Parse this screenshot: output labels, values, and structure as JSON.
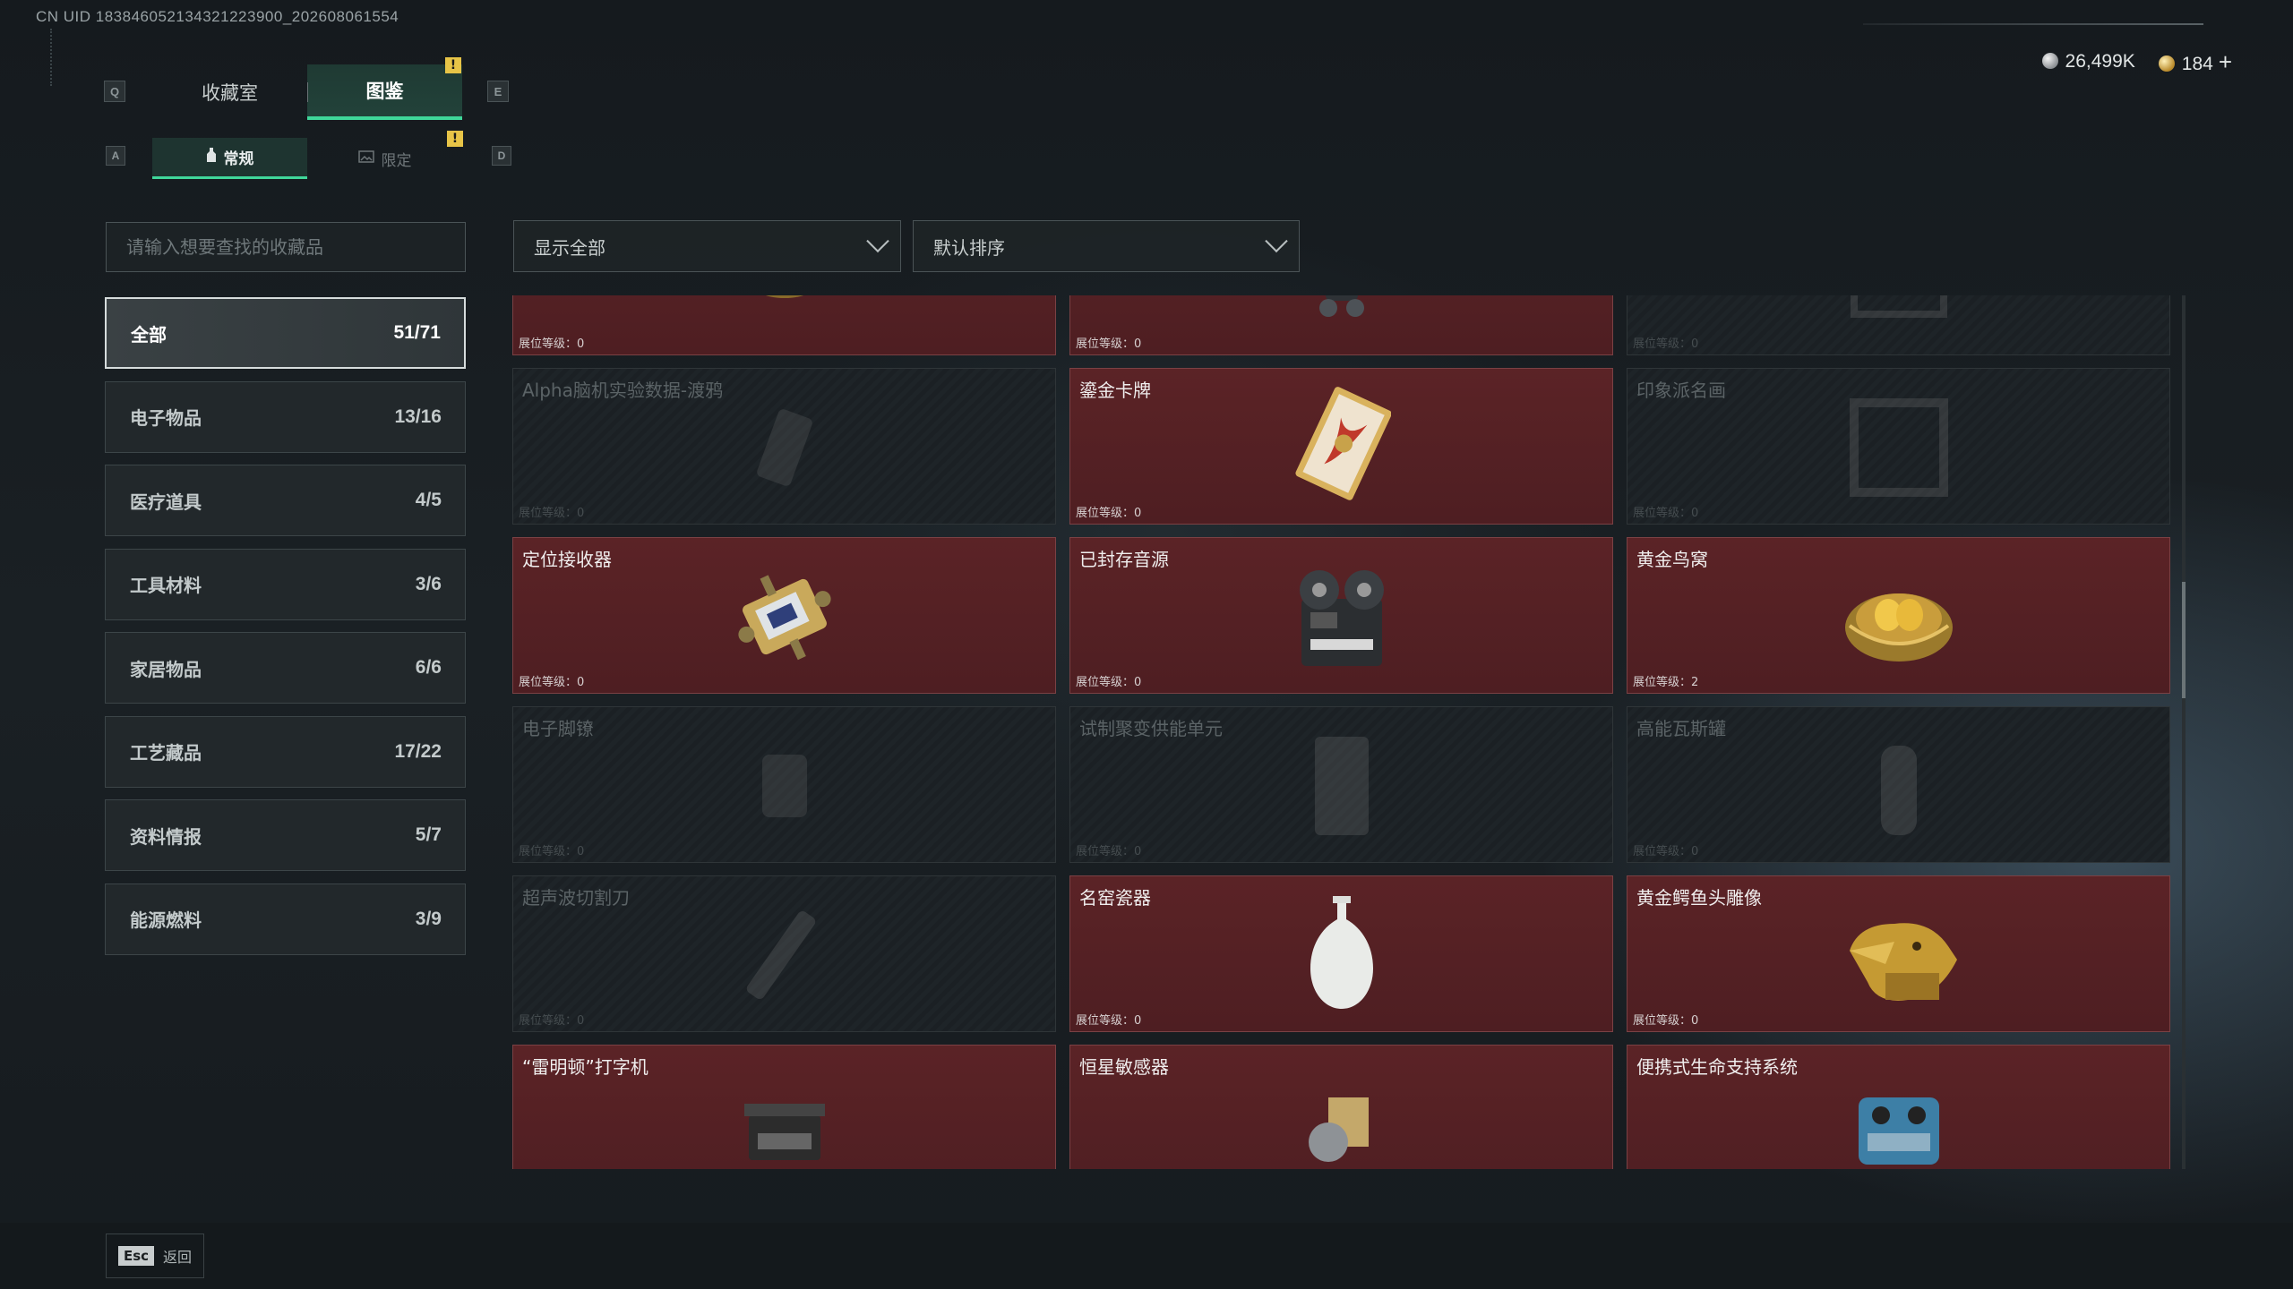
{
  "header": {
    "uid": "CN UID 18384605213432122390​0_202608061554",
    "tabs": [
      {
        "label": "收藏室",
        "active": false
      },
      {
        "label": "图鉴",
        "active": true
      }
    ],
    "tab_keys": {
      "prev": "Q",
      "next": "E"
    },
    "subtabs": [
      {
        "label": "常规",
        "active": true
      },
      {
        "label": "限定",
        "active": false
      }
    ],
    "subtab_keys": {
      "prev": "A",
      "next": "D"
    },
    "warning_mark": "!"
  },
  "currency": {
    "silver": "26,499K",
    "gold": "184",
    "plus": "+"
  },
  "search": {
    "placeholder": "请输入想要查找的收藏品",
    "value": ""
  },
  "filters": {
    "show": "显示全部",
    "sort": "默认排序"
  },
  "categories": [
    {
      "label": "全部",
      "count": "51/71",
      "active": true
    },
    {
      "label": "电子物品",
      "count": "13/16"
    },
    {
      "label": "医疗道具",
      "count": "4/5"
    },
    {
      "label": "工具材料",
      "count": "3/6"
    },
    {
      "label": "家居物品",
      "count": "6/6"
    },
    {
      "label": "工艺藏品",
      "count": "17/22"
    },
    {
      "label": "资料情报",
      "count": "5/7"
    },
    {
      "label": "能源燃料",
      "count": "3/9"
    }
  ],
  "items": [
    {
      "name": "",
      "level": "展位等级：0",
      "owned": true,
      "icon": "caviar-tin-icon"
    },
    {
      "name": "",
      "level": "展位等级：0",
      "owned": true,
      "icon": "device-icon"
    },
    {
      "name": "",
      "level": "展位等级：0",
      "owned": false,
      "icon": "frame-icon"
    },
    {
      "name": "Alpha脑机实验数据-渡鸦",
      "level": "展位等级：0",
      "owned": false,
      "icon": "data-drive-icon"
    },
    {
      "name": "鎏金卡牌",
      "level": "展位等级：0",
      "owned": true,
      "icon": "gilded-card-icon"
    },
    {
      "name": "印象派名画",
      "level": "展位等级：0",
      "owned": false,
      "icon": "painting-icon"
    },
    {
      "name": "定位接收器",
      "level": "展位等级：0",
      "owned": true,
      "icon": "locator-receiver-icon"
    },
    {
      "name": "已封存音源",
      "level": "展位等级：0",
      "owned": true,
      "icon": "tape-recorder-icon"
    },
    {
      "name": "黄金鸟窝",
      "level": "展位等级：2",
      "owned": true,
      "icon": "golden-nest-icon"
    },
    {
      "name": "电子脚镣",
      "level": "展位等级：0",
      "owned": false,
      "icon": "ankle-monitor-icon"
    },
    {
      "name": "试制聚变供能单元",
      "level": "展位等级：0",
      "owned": false,
      "icon": "fusion-cell-icon"
    },
    {
      "name": "高能瓦斯罐",
      "level": "展位等级：0",
      "owned": false,
      "icon": "gas-canister-icon"
    },
    {
      "name": "超声波切割刀",
      "level": "展位等级：0",
      "owned": false,
      "icon": "ultrasonic-cutter-icon"
    },
    {
      "name": "名窑瓷器",
      "level": "展位等级：0",
      "owned": true,
      "icon": "porcelain-vase-icon"
    },
    {
      "name": "黄金鳄鱼头雕像",
      "level": "展位等级：0",
      "owned": true,
      "icon": "gold-crocodile-icon"
    },
    {
      "name": "“雷明顿”打字机",
      "level": "",
      "owned": true,
      "icon": "typewriter-icon"
    },
    {
      "name": "恒星敏感器",
      "level": "",
      "owned": true,
      "icon": "star-sensor-icon"
    },
    {
      "name": "便携式生命支持系统",
      "level": "",
      "owned": true,
      "icon": "life-support-icon"
    }
  ],
  "footer": {
    "esc_key": "Esc",
    "back_label": "返回"
  }
}
